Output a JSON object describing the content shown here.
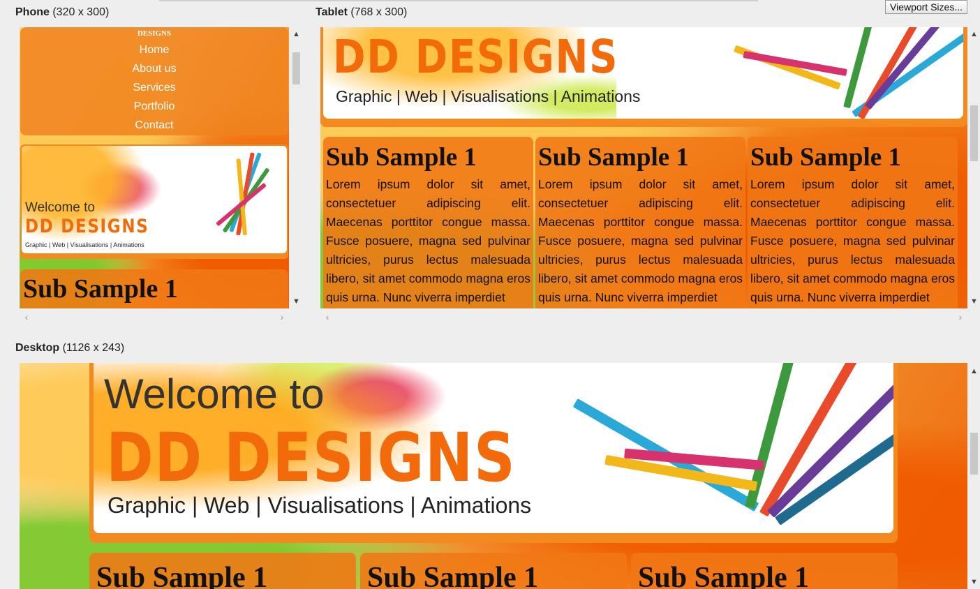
{
  "toolbar": {
    "viewport_button": "Viewport Sizes..."
  },
  "panes": {
    "phone": {
      "name": "Phone",
      "size": "(320 x 300)"
    },
    "tablet": {
      "name": "Tablet",
      "size": "(768 x 300)"
    },
    "desktop": {
      "name": "Desktop",
      "size": "(1126 x 243)"
    }
  },
  "site": {
    "logo_small": "DESIGNS",
    "nav": [
      "Home",
      "About us",
      "Services",
      "Portfolio",
      "Contact"
    ],
    "welcome": "Welcome to",
    "brand": "DD DESIGNS",
    "tagline": "Graphic | Web | Visualisations | Animations",
    "sub_title": "Sub Sample 1",
    "lorem": "Lorem ipsum dolor sit amet, consectetuer adipiscing elit. Maecenas porttitor congue massa. Fusce posuere, magna sed pulvinar ultricies, purus lectus malesuada libero, sit amet commodo magna eros quis urna. Nunc viverra imperdiet"
  },
  "colors": {
    "accent": "#f26a0a",
    "panel_orange": "#f07814"
  },
  "icons": {
    "scroll_up": "triangle-up",
    "scroll_down": "triangle-down",
    "scroll_left": "chevron-left",
    "scroll_right": "chevron-right"
  }
}
